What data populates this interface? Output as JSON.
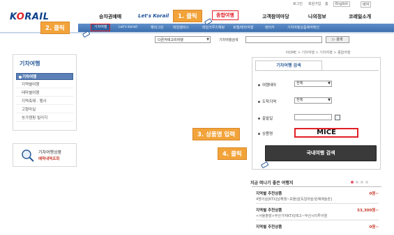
{
  "util_links": [
    "로그인",
    "회원가입",
    "홈",
    "English",
    "예약"
  ],
  "logo": {
    "text_k": "K",
    "text_o": "O",
    "text_rail": "RAIL"
  },
  "main_nav": [
    "승차권예매",
    "Let's Korail",
    "종합여행",
    "고객참여마당",
    "나의정보",
    "코레일소개"
  ],
  "sub_nav": [
    "기차여행",
    "Let's korail",
    "해외그린",
    "레일텔비스",
    "레일크루즈해랑",
    "호텔/테마여행",
    "렌터카",
    "기차여행상품예약확인"
  ],
  "callouts": {
    "step1": "1. 클릭",
    "step2": "2. 클릭",
    "step3": "3. 상품명 입력",
    "step4": "4. 클릭"
  },
  "search": {
    "category_value": "다른카테고리여행",
    "product_label": "기차여행검색",
    "button": "▷ 검색"
  },
  "sidebar": {
    "title": "기차여행",
    "items": [
      "기차여행",
      "지역별여행",
      "테마별여행",
      "지역축제 · 행사",
      "고향마실",
      "농가캠핑 빌리지"
    ],
    "active_index": 0
  },
  "side_banner": {
    "line1": "기차여행상품",
    "line2": "예약내역조회"
  },
  "breadcrumb": "HOME > 기차여행 > 기차여행 > 종합여행",
  "panel": {
    "tab": "기차여행 검색",
    "fields": [
      {
        "label": "여행테마",
        "value": "전체"
      },
      {
        "label": "도착지역",
        "value": "전체"
      },
      {
        "label": "출발일",
        "value": ""
      },
      {
        "label": "상품명",
        "value": "MICE"
      }
    ],
    "submit": "국내여행 검색"
  },
  "recommend": {
    "title": "지금 떠나기 좋은 여행지",
    "items": [
      {
        "name": "지역별 추천상품",
        "price": "0원~",
        "desc": "4명이상[KTX]남해웰~보물섬[독일마을/원예예술촌]"
      },
      {
        "name": "지역별 추천상품",
        "price": "53,300원~",
        "desc": "<서울출발>부산가자KTX]태고~부산시티투어열"
      },
      {
        "name": "지역별 추천상품",
        "price": "0원~",
        "desc": ""
      }
    ]
  },
  "colors": {
    "brand_blue": "#0a3f8a",
    "highlight_red": "#e21f26",
    "callout_orange": "#f2a33a"
  }
}
